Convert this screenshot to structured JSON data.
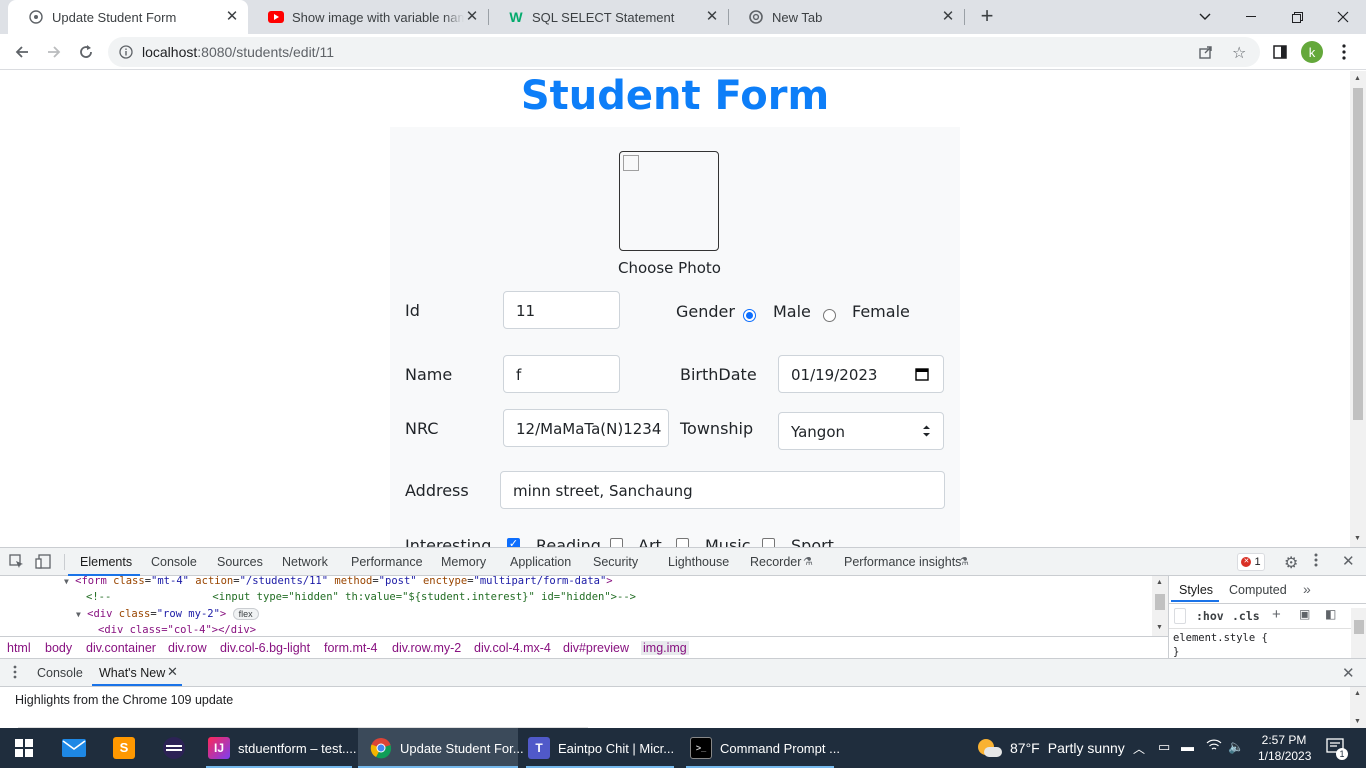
{
  "browser": {
    "tabs": [
      {
        "title": "Update Student Form",
        "icon": "globe-icon",
        "active": true
      },
      {
        "title": "Show image with variable name",
        "icon": "youtube-icon"
      },
      {
        "title": "SQL SELECT Statement",
        "icon": "w3schools-icon"
      },
      {
        "title": "New Tab",
        "icon": "chrome-icon"
      }
    ],
    "new_tab_symbol": "+",
    "url_host": "localhost",
    "url_path": ":8080/students/edit/11",
    "profile_initial": "k"
  },
  "page": {
    "title": "Student Form",
    "photo_label": "Choose Photo",
    "fields": {
      "id_label": "Id",
      "id_value": "11",
      "gender_label": "Gender",
      "male_label": "Male",
      "female_label": "Female",
      "gender_selected": "Male",
      "name_label": "Name",
      "name_value": "f",
      "birthdate_label": "BirthDate",
      "birthdate_value": "01/19/2023",
      "nrc_label": "NRC",
      "nrc_value": "12/MaMaTa(N)1234",
      "township_label": "Township",
      "township_value": "Yangon",
      "address_label": "Address",
      "address_value": "minn street, Sanchaung",
      "interesting_label": "Interesting",
      "interests": [
        {
          "label": "Reading",
          "checked": true
        },
        {
          "label": "Art",
          "checked": false
        },
        {
          "label": "Music",
          "checked": false
        },
        {
          "label": "Sport",
          "checked": false
        }
      ]
    }
  },
  "devtools": {
    "tabs": [
      "Elements",
      "Console",
      "Sources",
      "Network",
      "Performance",
      "Memory",
      "Application",
      "Security",
      "Lighthouse",
      "Recorder",
      "Performance insights"
    ],
    "error_count": "1",
    "dom_lines": {
      "line1_tag": "<form ",
      "line1_a1": "class",
      "line1_v1": "\"mt-4\"",
      "line1_a2": "action",
      "line1_v2": "\"/students/11\"",
      "line1_a3": "method",
      "line1_v3": "\"post\"",
      "line1_a4": "enctype",
      "line1_v4": "\"multipart/form-data\"",
      "line2_comment": "<!--                <input type=\"hidden\" th:value=\"${student.interest}\" id=\"hidden\">-->",
      "line3_tag": "<div ",
      "line3_a1": "class",
      "line3_v1": "\"row my-2\"",
      "line3_badge": "flex",
      "line4": "<div class=\"col-4\"></div>"
    },
    "breadcrumbs": [
      "html",
      "body",
      "div.container",
      "div.row",
      "div.col-6.bg-light",
      "form.mt-4",
      "div.row.my-2",
      "div.col-4.mx-4",
      "div#preview",
      "img.img"
    ],
    "styles_tabs": [
      "Styles",
      "Computed"
    ],
    "styles_more": "»",
    "hov": ":hov",
    "cls": ".cls",
    "element_style": "element.style {",
    "element_style_close": "}",
    "drawer_tabs": [
      "Console",
      "What's New"
    ],
    "drawer_text": "Highlights from the Chrome 109 update"
  },
  "taskbar": {
    "items": [
      {
        "label": "stduentform – test....",
        "icon": "intellij-icon",
        "active": false
      },
      {
        "label": "Update Student For...",
        "icon": "chrome-icon",
        "active": true
      },
      {
        "label": "Eaintpo Chit | Micr...",
        "icon": "teams-icon",
        "active": false
      },
      {
        "label": "Command Prompt ...",
        "icon": "cmd-icon",
        "active": false
      }
    ],
    "weather_temp": "87°F",
    "weather_text": "Partly sunny",
    "time": "2:57 PM",
    "date": "1/18/2023",
    "notification_count": "1"
  }
}
